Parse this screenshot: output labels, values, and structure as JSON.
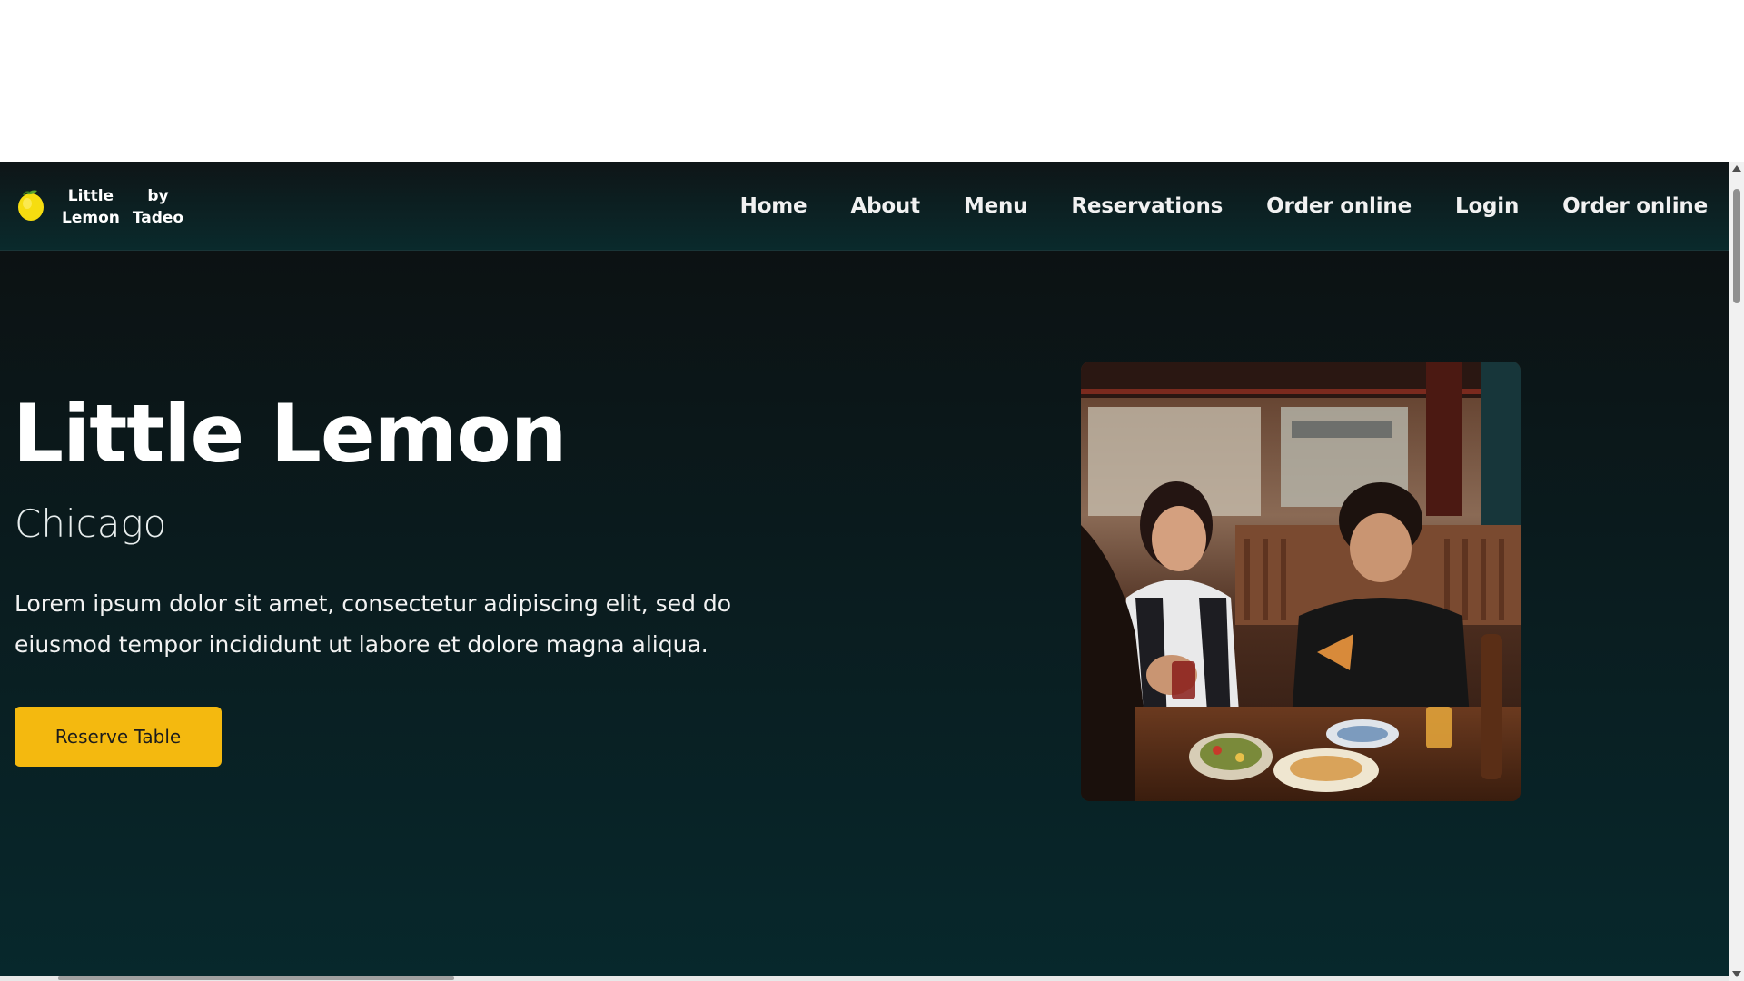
{
  "header": {
    "brand": {
      "line1": [
        "Little",
        "Lemon"
      ],
      "line2": [
        "by",
        "Tadeo"
      ],
      "logo_icon": "lemon-icon"
    },
    "nav": [
      {
        "label": "Home"
      },
      {
        "label": "About"
      },
      {
        "label": "Menu"
      },
      {
        "label": "Reservations"
      },
      {
        "label": "Order online"
      },
      {
        "label": "Login"
      },
      {
        "label": "Order online"
      }
    ]
  },
  "hero": {
    "title": "Little Lemon",
    "subtitle": "Chicago",
    "description": "Lorem ipsum dolor sit amet, consectetur adipiscing elit, sed do eiusmod tempor incididunt ut labore et dolore magna aliqua.",
    "button_label": "Reserve Table",
    "image_icon": "restaurant-photo"
  },
  "colors": {
    "accent": "#f4b90f",
    "header_bg": "#0a2a2c",
    "hero_bg": "#07282c",
    "text": "#ffffff"
  }
}
